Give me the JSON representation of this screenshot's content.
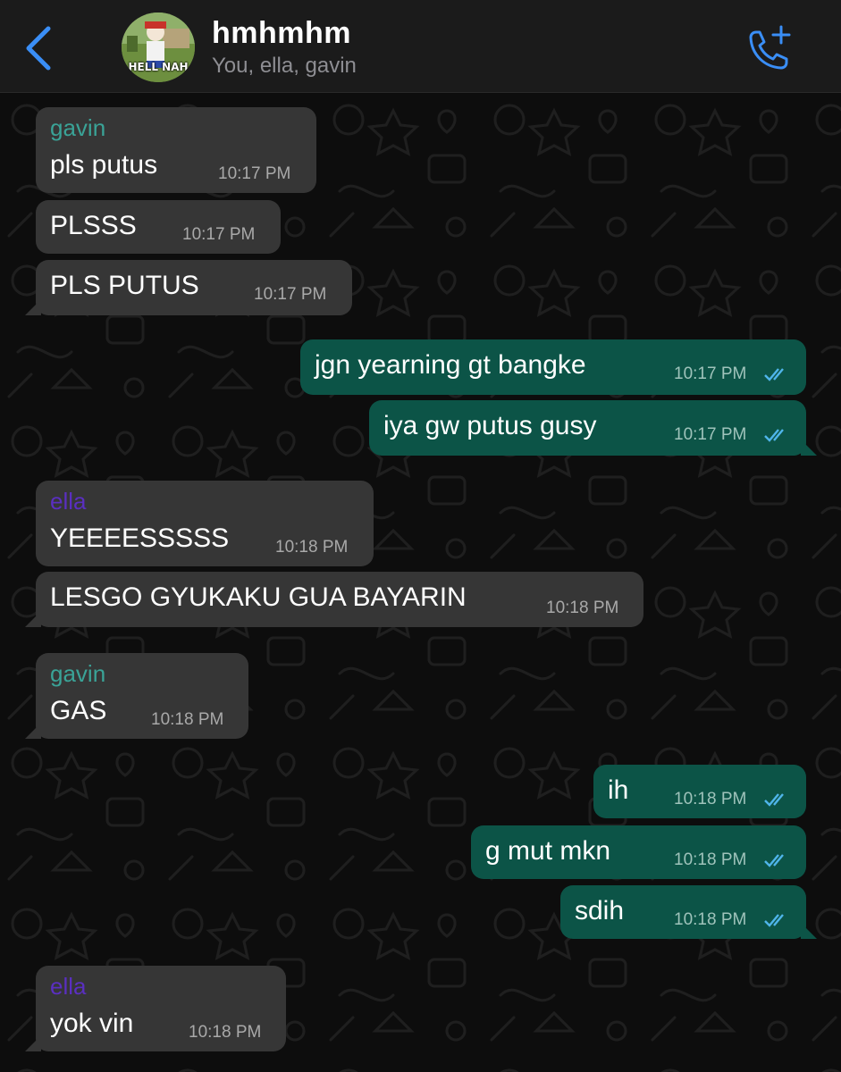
{
  "header": {
    "title": "hmhmhm",
    "subtitle": "You, ella, gavin",
    "avatar_caption": "HELL NAH",
    "accent_color": "#3a8ef6",
    "back_icon": "chevron-left-icon",
    "call_icon": "phone-plus-icon"
  },
  "colors": {
    "incoming_bubble": "#363636",
    "outgoing_bubble": "#0c5447",
    "gavin": "#3aa397",
    "ella": "#5a2fc0",
    "read_ticks": "#4fb5ea"
  },
  "messages": [
    {
      "sender": "gavin",
      "text": "pls putus",
      "time": "10:17 PM"
    },
    {
      "text": "PLSSS",
      "time": "10:17 PM"
    },
    {
      "text": "PLS PUTUS",
      "time": "10:17 PM"
    },
    {
      "text": "jgn yearning gt bangke",
      "time": "10:17 PM"
    },
    {
      "text": "iya gw putus gusy",
      "time": "10:17 PM"
    },
    {
      "sender": "ella",
      "text": "YEEEESSSSS",
      "time": "10:18 PM"
    },
    {
      "text": "LESGO GYUKAKU GUA BAYARIN",
      "time": "10:18 PM"
    },
    {
      "sender": "gavin",
      "text": "GAS",
      "time": "10:18 PM"
    },
    {
      "text": "ih",
      "time": "10:18 PM"
    },
    {
      "text": "g mut mkn",
      "time": "10:18 PM"
    },
    {
      "text": "sdih",
      "time": "10:18 PM"
    },
    {
      "sender": "ella",
      "text": "yok vin",
      "time": "10:18 PM"
    }
  ]
}
